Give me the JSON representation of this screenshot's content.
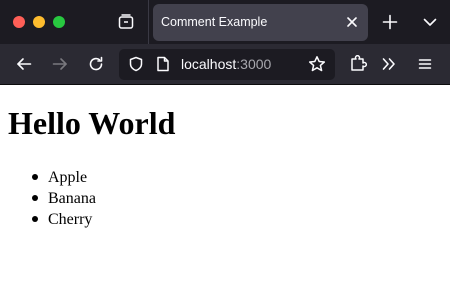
{
  "browser": {
    "tab": {
      "title": "Comment Example"
    },
    "url": {
      "host": "localhost",
      "port": ":3000"
    },
    "icons": {
      "tab_list": "tab-list-icon",
      "tab_close": "close-icon",
      "new_tab": "plus-icon",
      "all_tabs": "chevron-down-icon",
      "back": "arrow-left-icon",
      "forward": "arrow-right-icon",
      "reload": "reload-icon",
      "shield": "shield-icon",
      "page": "page-icon",
      "bookmark": "star-icon",
      "extensions": "puzzle-icon",
      "overflow": "double-chevron-right-icon",
      "menu": "hamburger-menu-icon"
    },
    "colors": {
      "tabbar_bg": "#1c1b22",
      "active_tab_bg": "#42414d",
      "navbar_bg": "#2b2a33",
      "urlbar_bg": "#1c1b22",
      "close_dot": "#ff5f57",
      "minimize_dot": "#febc2e",
      "zoom_dot": "#28c840"
    }
  },
  "page": {
    "heading": "Hello World",
    "items": [
      {
        "label": "Apple"
      },
      {
        "label": "Banana"
      },
      {
        "label": "Cherry"
      }
    ]
  }
}
